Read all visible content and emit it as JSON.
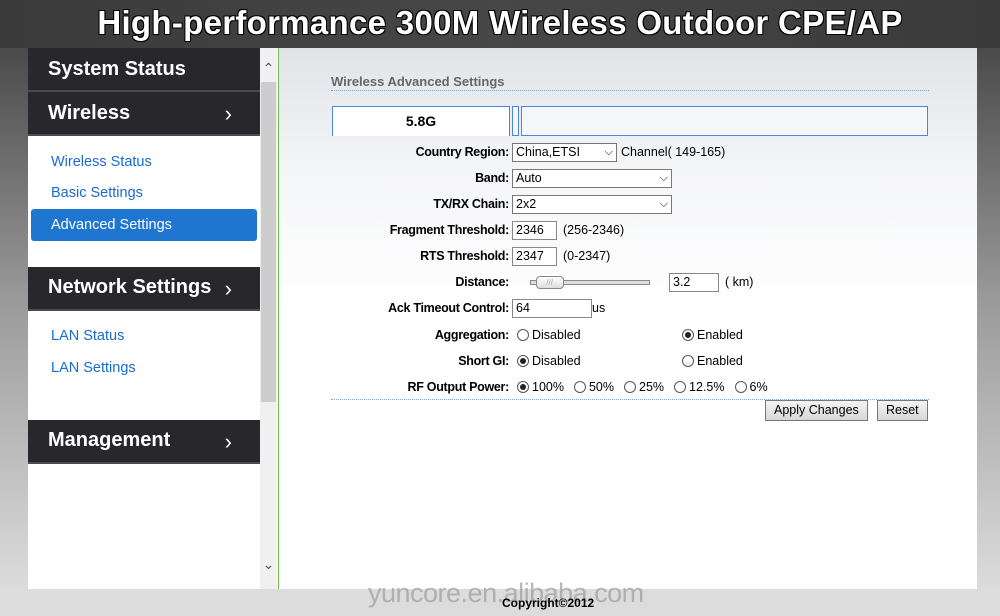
{
  "banner": {
    "title": "High-performance 300M Wireless Outdoor CPE/AP"
  },
  "sidebar": {
    "system_status": "System Status",
    "wireless": {
      "label": "Wireless",
      "items": [
        "Wireless Status",
        "Basic Settings",
        "Advanced Settings"
      ],
      "active": "Advanced Settings"
    },
    "network": {
      "label": "Network Settings",
      "items": [
        "LAN Status",
        "LAN Settings"
      ]
    },
    "management": {
      "label": "Management"
    },
    "chevron": "›"
  },
  "main": {
    "section_title": "Wireless Advanced Settings",
    "tabs": [
      {
        "label": "5.8G",
        "active": true
      }
    ],
    "fields": {
      "country_region": {
        "label": "Country Region:",
        "value": "China,ETSI",
        "note": "Channel( 149-165)"
      },
      "band": {
        "label": "Band:",
        "value": "Auto"
      },
      "txrx_chain": {
        "label": "TX/RX Chain:",
        "value": "2x2"
      },
      "fragment_threshold": {
        "label": "Fragment Threshold:",
        "value": "2346",
        "note": "(256-2346)"
      },
      "rts_threshold": {
        "label": "RTS Threshold:",
        "value": "2347",
        "note": "(0-2347)"
      },
      "distance": {
        "label": "Distance:",
        "value": "3.2",
        "unit": "( km)",
        "slider_fraction": 0.05
      },
      "ack_timeout": {
        "label": "Ack Timeout Control:",
        "value": "64",
        "unit": "us"
      },
      "aggregation": {
        "label": "Aggregation:",
        "options": [
          "Disabled",
          "Enabled"
        ],
        "selected": "Enabled"
      },
      "short_gi": {
        "label": "Short GI:",
        "options": [
          "Disabled",
          "Enabled"
        ],
        "selected": "Disabled"
      },
      "rf_output_power": {
        "label": "RF Output Power:",
        "options": [
          "100%",
          "50%",
          "25%",
          "12.5%",
          "6%"
        ],
        "selected": "100%"
      }
    },
    "buttons": {
      "apply": "Apply Changes",
      "reset": "Reset"
    }
  },
  "footer": {
    "copyright": "Copyright©2012",
    "watermark": "yuncore.en.alibaba.com"
  }
}
